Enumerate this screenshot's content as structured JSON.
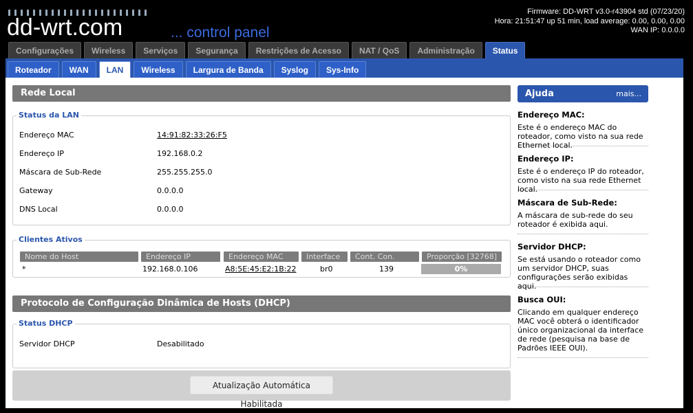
{
  "header": {
    "brand": "dd-wrt.com",
    "subtitle": "... control panel",
    "firmware": "Firmware: DD-WRT v3.0-r43904 std (07/23/20)",
    "time": "Hora: 21:51:47 up 51 min, load average: 0.00, 0.00, 0.00",
    "wan_ip": "WAN IP: 0.0.0.0"
  },
  "main_tabs": [
    {
      "label": "Configurações"
    },
    {
      "label": "Wireless"
    },
    {
      "label": "Serviços"
    },
    {
      "label": "Segurança"
    },
    {
      "label": "Restrições de Acesso"
    },
    {
      "label": "NAT / QoS"
    },
    {
      "label": "Administração"
    },
    {
      "label": "Status"
    }
  ],
  "sub_tabs": [
    {
      "label": "Roteador"
    },
    {
      "label": "WAN"
    },
    {
      "label": "LAN"
    },
    {
      "label": "Wireless"
    },
    {
      "label": "Largura de Banda"
    },
    {
      "label": "Syslog"
    },
    {
      "label": "Sys-Info"
    }
  ],
  "lan": {
    "title": "Rede Local",
    "status_legend": "Status da LAN",
    "rows": [
      {
        "label": "Endereço MAC",
        "value": "14:91:82:33:26:F5"
      },
      {
        "label": "Endereço IP",
        "value": "192.168.0.2"
      },
      {
        "label": "Máscara de Sub-Rede",
        "value": "255.255.255.0"
      },
      {
        "label": "Gateway",
        "value": "0.0.0.0"
      },
      {
        "label": "DNS Local",
        "value": "0.0.0.0"
      }
    ]
  },
  "clients": {
    "legend": "Clientes Ativos",
    "headers": [
      "Nome do Host",
      "Endereço IP",
      "Endereço MAC",
      "Interface",
      "Cont. Con.",
      "Proporção [32768]"
    ],
    "rows": [
      {
        "host": "*",
        "ip": "192.168.0.106",
        "mac": "A8:5E:45:E2:1B:22",
        "iface": "br0",
        "conns": "139",
        "ratio": "0%"
      }
    ]
  },
  "dhcp": {
    "title": "Protocolo de Configuração Dinâmica de Hosts (DHCP)",
    "legend": "Status DHCP",
    "server_label": "Servidor DHCP",
    "server_value": "Desabilitado"
  },
  "autorefresh": "Atualização Automática Habilitada",
  "help": {
    "title": "Ajuda",
    "more": "mais...",
    "items": [
      {
        "heading": "Endereço MAC:",
        "text": "Este é o endereço MAC do roteador, como visto na sua rede Ethernet local."
      },
      {
        "heading": "Endereço IP:",
        "text": "Este é o endereço IP do roteador, como visto na sua rede Ethernet local."
      },
      {
        "heading": "Máscara de Sub-Rede:",
        "text": "A máscara de sub-rede do seu roteador é exibida aqui."
      },
      {
        "heading": "Servidor DHCP:",
        "text": "Se está usando o roteador como um servidor DHCP, suas configurações serão exibidas aqui."
      },
      {
        "heading": "Busca OUI:",
        "text": "Clicando em qualquer endereço MAC você obterá o identificador único organizacional da interface de rede (pesquisa na base de Padrões IEEE OUI)."
      }
    ]
  },
  "colors": {
    "accent": "#2b56ad",
    "section_header": "#777777",
    "legend_text": "#2b56ad"
  }
}
